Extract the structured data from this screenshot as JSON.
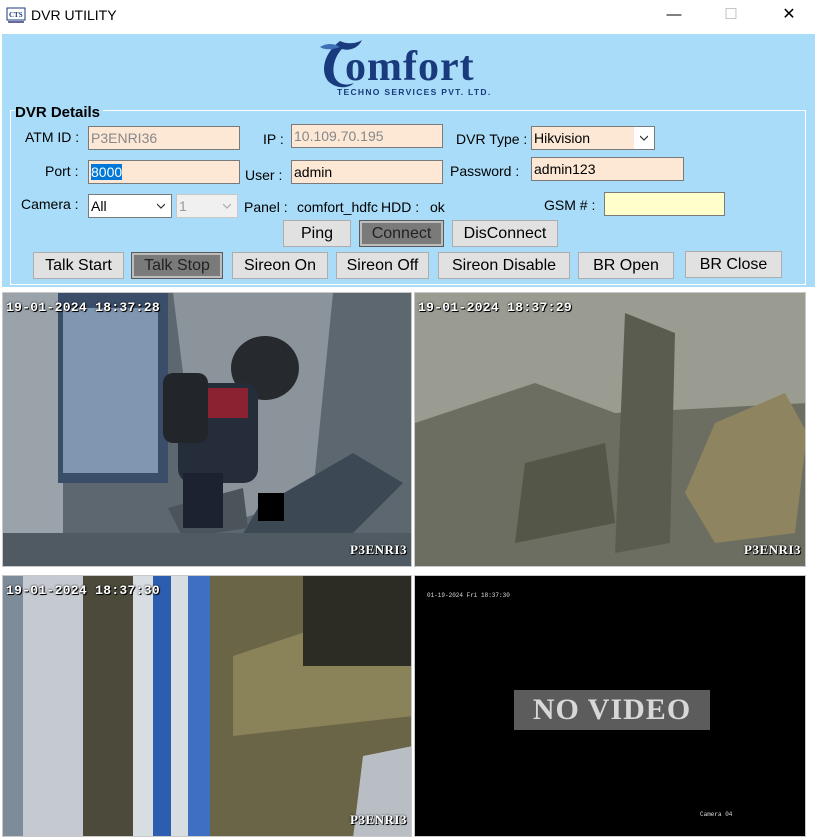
{
  "window": {
    "title": "DVR UTILITY",
    "minimize": "—",
    "maximize": "☐",
    "close": "✕"
  },
  "logo": {
    "word": "omfort",
    "subtitle": "TECHNO SERVICES PVT. LTD."
  },
  "details": {
    "group_title": "DVR Details",
    "atm_id_label": "ATM ID :",
    "atm_id_value": "P3ENRI36",
    "ip_label": "IP :",
    "ip_value": "10.109.70.195",
    "dvr_type_label": "DVR Type :",
    "dvr_type_value": "Hikvision",
    "port_label": "Port :",
    "port_value": "8000",
    "user_label": "User :",
    "user_value": "admin",
    "password_label": "Password :",
    "password_value": "admin123",
    "camera_label": "Camera :",
    "camera_value": "All",
    "camera_channel_value": "1",
    "panel_label": "Panel :",
    "panel_value": "comfort_hdfc",
    "hdd_label": "HDD :",
    "hdd_value": "ok",
    "gsm_label": "GSM # :",
    "gsm_value": ""
  },
  "buttons": {
    "ping": "Ping",
    "connect": "Connect",
    "disconnect": "DisConnect",
    "talk_start": "Talk Start",
    "talk_stop": "Talk Stop",
    "sireon_on": "Sireon On",
    "sireon_off": "Sireon Off",
    "sireon_disable": "Sireon Disable",
    "br_open": "BR Open",
    "br_close": "BR Close"
  },
  "cameras": [
    {
      "timestamp": "19-01-2024 18:37:28",
      "id": "P3ENRI3"
    },
    {
      "timestamp": "19-01-2024 18:37:29",
      "id": "P3ENRI3"
    },
    {
      "timestamp": "19-01-2024 18:37:30",
      "id": "P3ENRI3"
    },
    {
      "timestamp": "01-19-2024 Fri 18:37:30",
      "status": "NO VIDEO",
      "label": "Camera 04"
    }
  ],
  "colors": {
    "panel_bg": "#a8dcf8",
    "field_bg": "#fce8d5",
    "gsm_bg": "#ffffcc",
    "logo": "#1a3a7e"
  }
}
